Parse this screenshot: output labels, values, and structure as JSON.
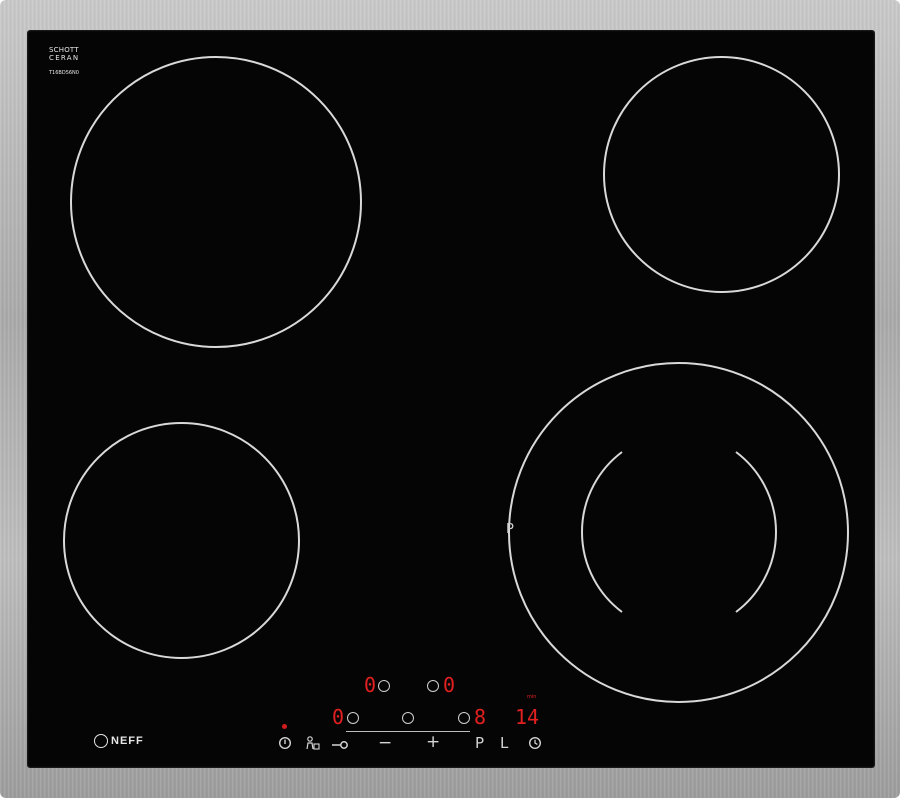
{
  "glass_brand": {
    "line1": "SCHOTT",
    "line2": "CERAN",
    "model": "T16BD56N0"
  },
  "zones": [
    {
      "name": "front-left-large",
      "type": "single"
    },
    {
      "name": "rear-right-medium",
      "type": "single"
    },
    {
      "name": "front-left-small",
      "type": "single"
    },
    {
      "name": "front-right-dual",
      "type": "dual",
      "label": "P"
    }
  ],
  "display": {
    "top_left_level": "0",
    "top_right_level": "0",
    "bottom_left_level": "0",
    "bottom_right_level": "8",
    "timer_value": "14",
    "timer_unit": "min"
  },
  "controls": {
    "power_icon": "power-icon",
    "child_lock_icon": "child-lock-icon",
    "key_icon": "key-icon",
    "minus_label": "−",
    "plus_label": "+",
    "p_label": "P",
    "l_label": "L",
    "timer_icon": "timer-icon"
  },
  "logo": {
    "text": "NEFF"
  },
  "colors": {
    "glass": "#050506",
    "zone_outline": "#d9d9d9",
    "display_red": "#e22020",
    "frame": "#b5b5b5"
  }
}
